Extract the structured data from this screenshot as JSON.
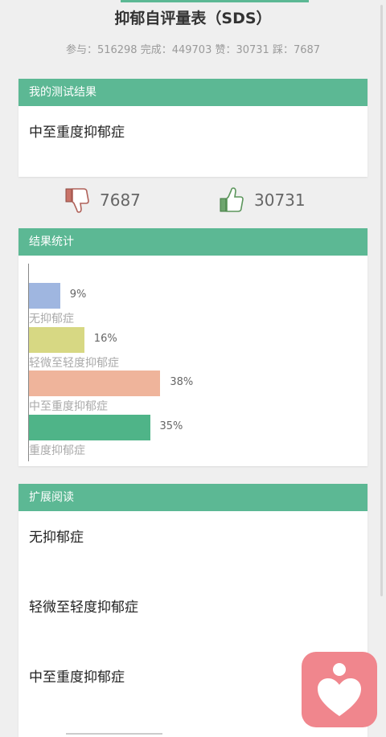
{
  "header": {
    "title": "抑郁自评量表（SDS）",
    "stats": "参与：516298 完成：449703 赞：30731 踩：7687"
  },
  "result_card": {
    "header": "我的测试结果",
    "text": "中至重度抑郁症"
  },
  "votes": {
    "dislike": "7687",
    "like": "30731"
  },
  "stats_card": {
    "header": "结果统计"
  },
  "chart_data": {
    "type": "bar",
    "orientation": "horizontal",
    "categories": [
      "无抑郁症",
      "轻微至轻度抑郁症",
      "中至重度抑郁症",
      "重度抑郁症"
    ],
    "values": [
      9,
      16,
      38,
      35
    ],
    "value_labels": [
      "9%",
      "16%",
      "38%",
      "35%"
    ],
    "colors": [
      "#9fb6e0",
      "#d7d883",
      "#efb49b",
      "#4fb488"
    ]
  },
  "reading_card": {
    "header": "扩展阅读",
    "items": [
      "无抑郁症",
      "轻微至轻度抑郁症",
      "中至重度抑郁症"
    ]
  },
  "icons": {
    "dislike": "thumbs-down-icon",
    "like": "thumbs-up-icon",
    "fab": "heart-person-icon"
  },
  "colors": {
    "accent": "#5cb894",
    "fab": "#f0868d"
  }
}
